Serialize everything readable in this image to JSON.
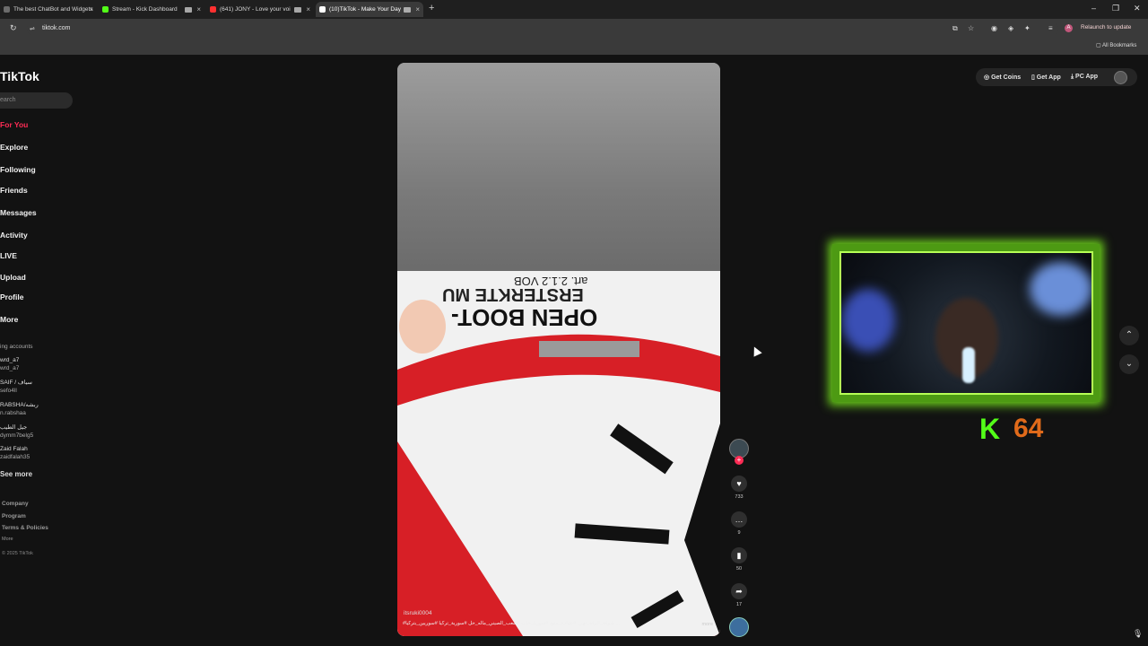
{
  "browser": {
    "tabs": [
      {
        "title": "The best ChatBot and Widgets",
        "favicon_color": "#6b6b6b"
      },
      {
        "title": "Stream - Kick Dashboard",
        "favicon_color": "#53fc18"
      },
      {
        "title": "(641) JONY - Love your voi",
        "favicon_color": "#ff3030"
      },
      {
        "title": "(10)TikTok - Make Your Day",
        "favicon_color": "#ffffff"
      }
    ],
    "url": "tiktok.com",
    "relaunch_label": "Relaunch to update",
    "all_bookmarks": "All Bookmarks",
    "profile_initial": "A"
  },
  "tiktok": {
    "logo": "TikTok",
    "search_placeholder": "earch",
    "nav": [
      "For You",
      "Explore",
      "Following",
      "Friends",
      "Messages",
      "Activity",
      "LIVE",
      "Upload",
      "Profile",
      "More"
    ],
    "following_title": "ing accounts",
    "accounts": [
      {
        "name": "wrd_a7",
        "handle": "wrd_a7"
      },
      {
        "name": "SAIF / سياف",
        "handle": "sefo4ll"
      },
      {
        "name": "RABSHA/ربشه",
        "handle": "n.rabshaa"
      },
      {
        "name": "جيل الطيب",
        "handle": "dymm7belg5"
      },
      {
        "name": "Zaid Falah",
        "handle": "zaidfalah35"
      }
    ],
    "see_more": "See more",
    "footer": [
      "Company",
      "Program",
      "Terms & Policies",
      "More"
    ],
    "copyright": "© 2025 TikTok",
    "top_buttons": {
      "coins": "Get Coins",
      "app": "Get App",
      "pc": "PC App"
    }
  },
  "video": {
    "sign_line1": "OPEN BOOT-",
    "sign_line2": "ERSTERKTE MU",
    "sign_line3": "art. 2.1.2 VOB",
    "username": "itsruki0004",
    "caption": "#شوفة_الرقة_نهر_ #عمادة_منبج #سوريا_حلب #شعب_الصيني_ماله_حل #سورية_تركيا #سوريين_بتركيا ...",
    "more_label": "more",
    "likes": "733",
    "comments": "9",
    "saves": "50",
    "shares": "17"
  },
  "overlay": {
    "kick_letter": "K",
    "kick_count": "64"
  },
  "colors": {
    "accent": "#fe2c55",
    "kick_green": "#53fc18",
    "count_orange": "#e06a1a"
  }
}
